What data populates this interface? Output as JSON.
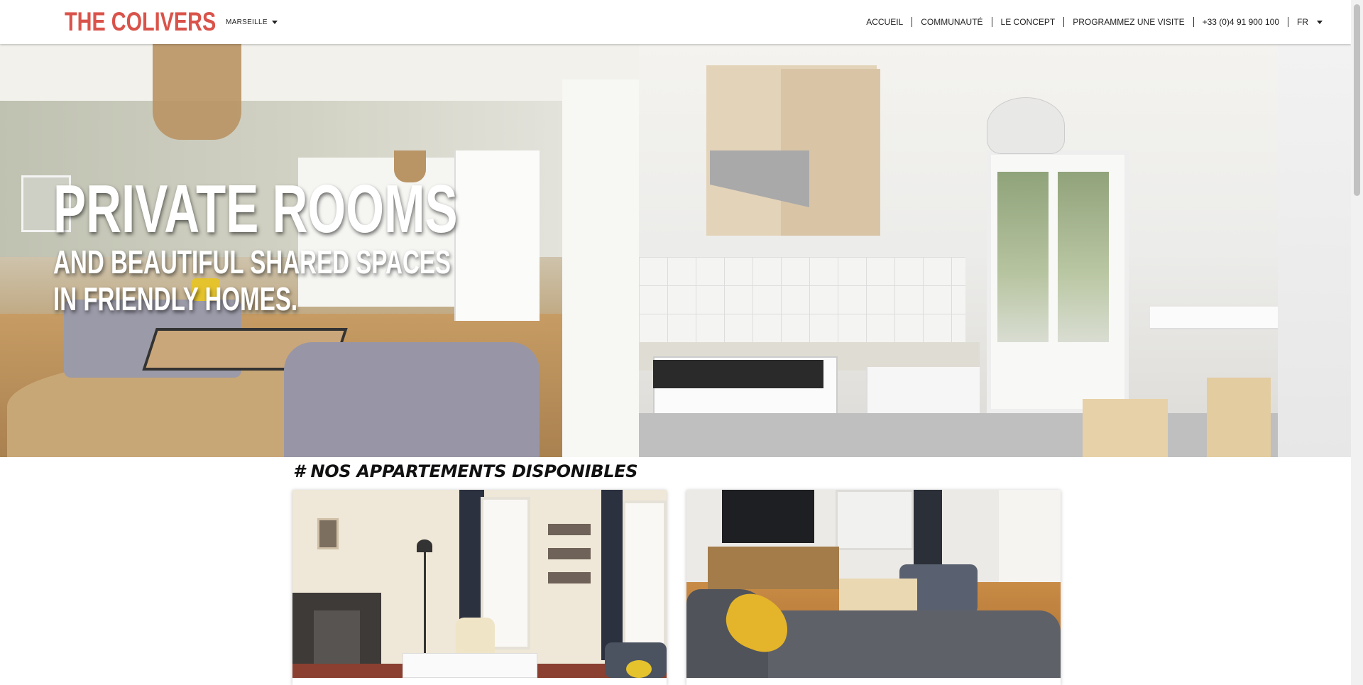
{
  "header": {
    "logo": "THE COLIVERS",
    "city_selector": "MARSEILLE",
    "nav": [
      "ACCUEIL",
      "COMMUNAUTÉ",
      "LE CONCEPT",
      "PROGRAMMEZ UNE VISITE",
      "+33 (0)4 91 900 100"
    ],
    "language": "FR"
  },
  "hero": {
    "title": "PRIVATE ROOMS",
    "subtitle_line1": "AND BEAUTIFUL SHARED SPACES",
    "subtitle_line2": "IN FRIENDLY HOMES."
  },
  "section": {
    "title": "# NOS APPARTEMENTS DISPONIBLES"
  },
  "colors": {
    "brand": "#d9534a",
    "text": "#222222",
    "background": "#ffffff"
  }
}
